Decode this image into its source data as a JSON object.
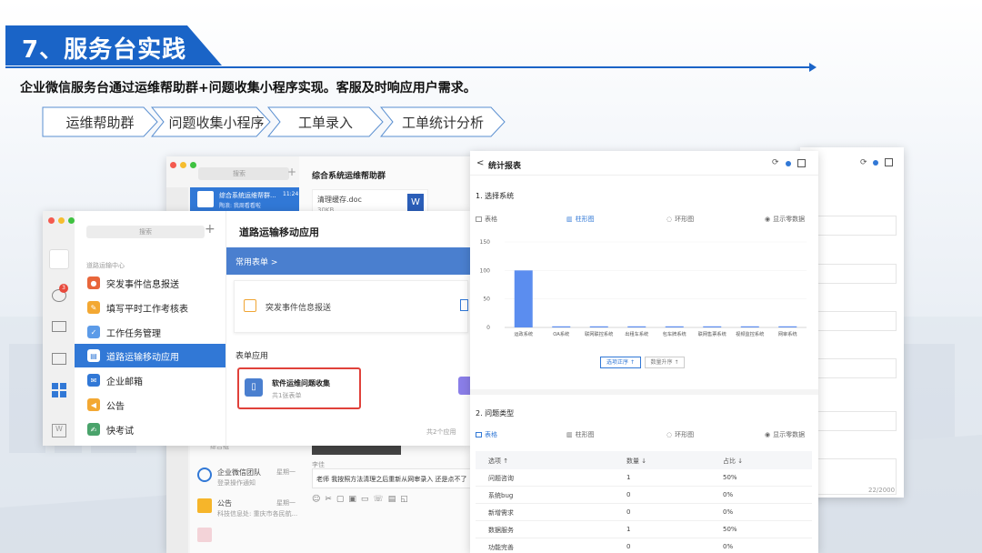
{
  "slide": {
    "title": "7、服务台实践",
    "subtitle": "企业微信服务台通过运维帮助群+问题收集小程序实现。客服及时响应用户需求。",
    "steps": [
      "运维帮助群",
      "问题收集小程序",
      "工单录入",
      "工单统计分析"
    ]
  },
  "chatwin": {
    "search": "搜索",
    "chat_title": "综合系统运维帮助群",
    "active_chat": {
      "name": "综合系统运维帮群...",
      "time": "11:24",
      "preview": "陶浪: 我周看看啦"
    },
    "file": {
      "name": "清理缓存.doc",
      "size": "30KB"
    },
    "lower_items": [
      {
        "name": "企业微信团队",
        "preview": "登录操作通知",
        "time": "星期一"
      },
      {
        "name": "公告",
        "preview": "科技信息处: 重庆市各民航...",
        "time": "星期一"
      }
    ],
    "sender": "李佳",
    "message": "老师 我按照方法清理之后重新从网审录入 还是点不了",
    "group_label": "综合组"
  },
  "appwin": {
    "search": "搜索",
    "section": "道路运输中心",
    "menu": [
      "突发事件信息报送",
      "填写平时工作考核表",
      "工作任务管理",
      "道路运输移动应用",
      "企业邮箱",
      "公告",
      "快考试"
    ],
    "selected_index": 3,
    "badge": "3",
    "app_title": "道路运输移动应用",
    "common_forms": "常用表单 >",
    "form_card": "突发事件信息报送",
    "form_apps_label": "表单应用",
    "highlight_card": {
      "name": "软件运维问题收集",
      "sub": "共1张表单"
    },
    "footer": "共2个应用"
  },
  "report": {
    "back": "<",
    "title": "统计报表",
    "section1": "1. 选择系统",
    "section2": "2. 问题类型",
    "tabs": [
      "表格",
      "柱形图",
      "环形图",
      "显示零数据"
    ],
    "sort_buttons": [
      "选项正序 ↑",
      "数量升序 ↑"
    ],
    "table_headers": [
      "选项 ↑",
      "数量 ↓",
      "占比 ↓"
    ],
    "table_rows": [
      [
        "问题咨询",
        "1",
        "50%"
      ],
      [
        "系统bug",
        "0",
        "0%"
      ],
      [
        "新增需求",
        "0",
        "0%"
      ],
      [
        "数据服务",
        "1",
        "50%"
      ],
      [
        "功能完善",
        "0",
        "0%"
      ]
    ],
    "char_count": "22/2000"
  },
  "chart_data": {
    "type": "bar",
    "categories": [
      "运政系统",
      "OA系统",
      "联网联控系统",
      "出租车系统",
      "包车牌系统",
      "联网售票系统",
      "视频监控系统",
      "网审系统"
    ],
    "values": [
      100,
      0,
      0,
      0,
      0,
      0,
      0,
      0
    ],
    "ylim": [
      0,
      150
    ],
    "yticks": [
      0,
      50,
      100,
      150
    ],
    "accent": "#5b8def"
  },
  "colors": {
    "brand": "#1a64c7",
    "app_blue": "#4a7fcf",
    "highlight_red": "#e0413a"
  }
}
